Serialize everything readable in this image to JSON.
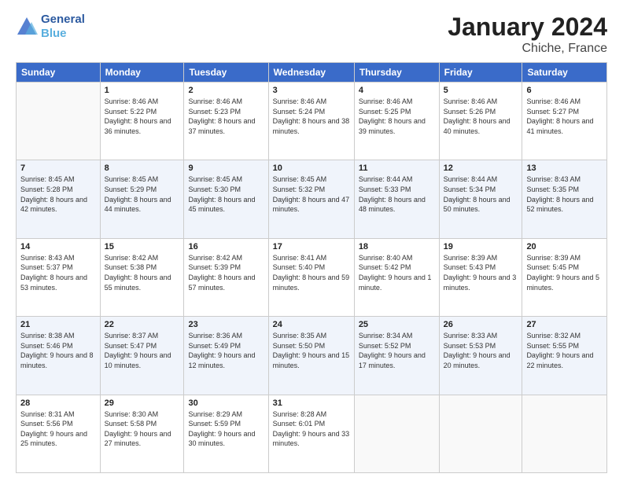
{
  "header": {
    "logo_line1": "General",
    "logo_line2": "Blue",
    "title": "January 2024",
    "subtitle": "Chiche, France"
  },
  "columns": [
    "Sunday",
    "Monday",
    "Tuesday",
    "Wednesday",
    "Thursday",
    "Friday",
    "Saturday"
  ],
  "weeks": [
    [
      {
        "day": "",
        "sunrise": "",
        "sunset": "",
        "daylight": ""
      },
      {
        "day": "1",
        "sunrise": "Sunrise: 8:46 AM",
        "sunset": "Sunset: 5:22 PM",
        "daylight": "Daylight: 8 hours and 36 minutes."
      },
      {
        "day": "2",
        "sunrise": "Sunrise: 8:46 AM",
        "sunset": "Sunset: 5:23 PM",
        "daylight": "Daylight: 8 hours and 37 minutes."
      },
      {
        "day": "3",
        "sunrise": "Sunrise: 8:46 AM",
        "sunset": "Sunset: 5:24 PM",
        "daylight": "Daylight: 8 hours and 38 minutes."
      },
      {
        "day": "4",
        "sunrise": "Sunrise: 8:46 AM",
        "sunset": "Sunset: 5:25 PM",
        "daylight": "Daylight: 8 hours and 39 minutes."
      },
      {
        "day": "5",
        "sunrise": "Sunrise: 8:46 AM",
        "sunset": "Sunset: 5:26 PM",
        "daylight": "Daylight: 8 hours and 40 minutes."
      },
      {
        "day": "6",
        "sunrise": "Sunrise: 8:46 AM",
        "sunset": "Sunset: 5:27 PM",
        "daylight": "Daylight: 8 hours and 41 minutes."
      }
    ],
    [
      {
        "day": "7",
        "sunrise": "Sunrise: 8:45 AM",
        "sunset": "Sunset: 5:28 PM",
        "daylight": "Daylight: 8 hours and 42 minutes."
      },
      {
        "day": "8",
        "sunrise": "Sunrise: 8:45 AM",
        "sunset": "Sunset: 5:29 PM",
        "daylight": "Daylight: 8 hours and 44 minutes."
      },
      {
        "day": "9",
        "sunrise": "Sunrise: 8:45 AM",
        "sunset": "Sunset: 5:30 PM",
        "daylight": "Daylight: 8 hours and 45 minutes."
      },
      {
        "day": "10",
        "sunrise": "Sunrise: 8:45 AM",
        "sunset": "Sunset: 5:32 PM",
        "daylight": "Daylight: 8 hours and 47 minutes."
      },
      {
        "day": "11",
        "sunrise": "Sunrise: 8:44 AM",
        "sunset": "Sunset: 5:33 PM",
        "daylight": "Daylight: 8 hours and 48 minutes."
      },
      {
        "day": "12",
        "sunrise": "Sunrise: 8:44 AM",
        "sunset": "Sunset: 5:34 PM",
        "daylight": "Daylight: 8 hours and 50 minutes."
      },
      {
        "day": "13",
        "sunrise": "Sunrise: 8:43 AM",
        "sunset": "Sunset: 5:35 PM",
        "daylight": "Daylight: 8 hours and 52 minutes."
      }
    ],
    [
      {
        "day": "14",
        "sunrise": "Sunrise: 8:43 AM",
        "sunset": "Sunset: 5:37 PM",
        "daylight": "Daylight: 8 hours and 53 minutes."
      },
      {
        "day": "15",
        "sunrise": "Sunrise: 8:42 AM",
        "sunset": "Sunset: 5:38 PM",
        "daylight": "Daylight: 8 hours and 55 minutes."
      },
      {
        "day": "16",
        "sunrise": "Sunrise: 8:42 AM",
        "sunset": "Sunset: 5:39 PM",
        "daylight": "Daylight: 8 hours and 57 minutes."
      },
      {
        "day": "17",
        "sunrise": "Sunrise: 8:41 AM",
        "sunset": "Sunset: 5:40 PM",
        "daylight": "Daylight: 8 hours and 59 minutes."
      },
      {
        "day": "18",
        "sunrise": "Sunrise: 8:40 AM",
        "sunset": "Sunset: 5:42 PM",
        "daylight": "Daylight: 9 hours and 1 minute."
      },
      {
        "day": "19",
        "sunrise": "Sunrise: 8:39 AM",
        "sunset": "Sunset: 5:43 PM",
        "daylight": "Daylight: 9 hours and 3 minutes."
      },
      {
        "day": "20",
        "sunrise": "Sunrise: 8:39 AM",
        "sunset": "Sunset: 5:45 PM",
        "daylight": "Daylight: 9 hours and 5 minutes."
      }
    ],
    [
      {
        "day": "21",
        "sunrise": "Sunrise: 8:38 AM",
        "sunset": "Sunset: 5:46 PM",
        "daylight": "Daylight: 9 hours and 8 minutes."
      },
      {
        "day": "22",
        "sunrise": "Sunrise: 8:37 AM",
        "sunset": "Sunset: 5:47 PM",
        "daylight": "Daylight: 9 hours and 10 minutes."
      },
      {
        "day": "23",
        "sunrise": "Sunrise: 8:36 AM",
        "sunset": "Sunset: 5:49 PM",
        "daylight": "Daylight: 9 hours and 12 minutes."
      },
      {
        "day": "24",
        "sunrise": "Sunrise: 8:35 AM",
        "sunset": "Sunset: 5:50 PM",
        "daylight": "Daylight: 9 hours and 15 minutes."
      },
      {
        "day": "25",
        "sunrise": "Sunrise: 8:34 AM",
        "sunset": "Sunset: 5:52 PM",
        "daylight": "Daylight: 9 hours and 17 minutes."
      },
      {
        "day": "26",
        "sunrise": "Sunrise: 8:33 AM",
        "sunset": "Sunset: 5:53 PM",
        "daylight": "Daylight: 9 hours and 20 minutes."
      },
      {
        "day": "27",
        "sunrise": "Sunrise: 8:32 AM",
        "sunset": "Sunset: 5:55 PM",
        "daylight": "Daylight: 9 hours and 22 minutes."
      }
    ],
    [
      {
        "day": "28",
        "sunrise": "Sunrise: 8:31 AM",
        "sunset": "Sunset: 5:56 PM",
        "daylight": "Daylight: 9 hours and 25 minutes."
      },
      {
        "day": "29",
        "sunrise": "Sunrise: 8:30 AM",
        "sunset": "Sunset: 5:58 PM",
        "daylight": "Daylight: 9 hours and 27 minutes."
      },
      {
        "day": "30",
        "sunrise": "Sunrise: 8:29 AM",
        "sunset": "Sunset: 5:59 PM",
        "daylight": "Daylight: 9 hours and 30 minutes."
      },
      {
        "day": "31",
        "sunrise": "Sunrise: 8:28 AM",
        "sunset": "Sunset: 6:01 PM",
        "daylight": "Daylight: 9 hours and 33 minutes."
      },
      {
        "day": "",
        "sunrise": "",
        "sunset": "",
        "daylight": ""
      },
      {
        "day": "",
        "sunrise": "",
        "sunset": "",
        "daylight": ""
      },
      {
        "day": "",
        "sunrise": "",
        "sunset": "",
        "daylight": ""
      }
    ]
  ]
}
